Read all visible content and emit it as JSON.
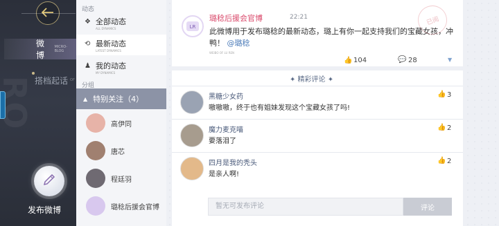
{
  "nav": {
    "weibo": "微博",
    "weibo_sub": "MICRO-BLOG",
    "dapei": "搭档起话",
    "dapei_sub": "OF",
    "post_label": "发布微博"
  },
  "sidebar": {
    "section_dynamics": "动态",
    "items": [
      {
        "label": "全部动态",
        "sub": "ALL DYNAMICS",
        "icon": "diamond-icon"
      },
      {
        "label": "最新动态",
        "sub": "LATEST DYNAMICS",
        "icon": "refresh-icon"
      },
      {
        "label": "我的动态",
        "sub": "MY DYNAMICS",
        "icon": "person-icon"
      }
    ],
    "section_groups": "分组",
    "group_label": "特别关注（4）",
    "contacts": [
      {
        "name": "高伊同",
        "color": "#e7b3a8"
      },
      {
        "name": "唐芯",
        "color": "#a08070"
      },
      {
        "name": "程廷羽",
        "color": "#6f6a72"
      },
      {
        "name": "璐稔后援会官博",
        "color": "#d8c8ee"
      }
    ]
  },
  "post": {
    "author": "璐稔后援会官博",
    "time": "22:21",
    "text": "此微博用于发布璐稔的最新动态，璐上有你一起支持我们的宝藏女孩，冲鸭！",
    "mention": "@璐稔",
    "tag": "WEIBO OF LU REN",
    "stamp": "已阅",
    "likes": "104",
    "comments": "28"
  },
  "featured_label": "✦ 精彩评论 ✦",
  "comments": [
    {
      "name": "黑糖少女药",
      "text": "嗷嗷嗷，终于也有姐妹发现这个宝藏女孩了吗!",
      "likes": "3",
      "color": "#9aa3b3"
    },
    {
      "name": "魔力麦克喵",
      "text": "要落泪了",
      "likes": "2",
      "color": "#a79c8e"
    },
    {
      "name": "四月是我的秃头",
      "text": "是亲人啊!",
      "likes": "2",
      "color": "#e3b98a"
    }
  ],
  "input": {
    "placeholder": "暂无可发布评论",
    "submit": "评论"
  }
}
